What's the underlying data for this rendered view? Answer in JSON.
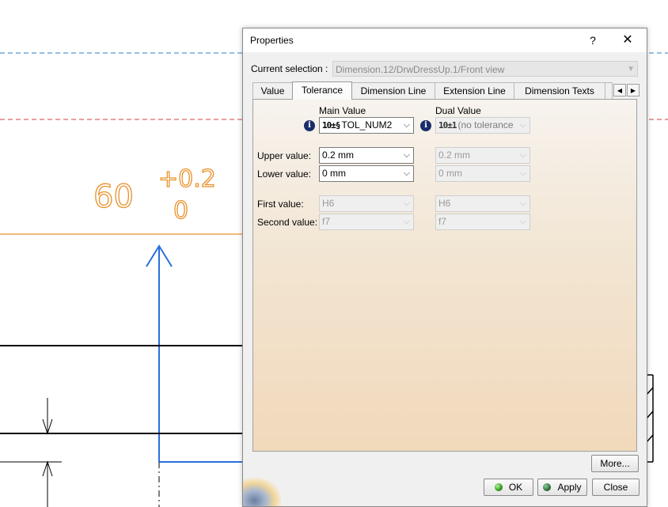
{
  "drawing": {
    "dimension_value": "60",
    "upper_tolerance": "+0.2",
    "lower_tolerance": "0",
    "colors": {
      "dim_text": "#e8912a",
      "dim_line": "#e8912a",
      "arrow": "#2a6fdb",
      "axis_blue": "#2a7fc4",
      "axis_red": "#d04040"
    }
  },
  "dialog": {
    "title": "Properties",
    "help_label": "?",
    "close_glyph": "✕",
    "current_selection_label": "Current selection :",
    "current_selection_value": "Dimension.12/DrwDressUp.1/Front view",
    "tabs": [
      "Value",
      "Tolerance",
      "Dimension Line",
      "Extension Line",
      "Dimension Texts"
    ],
    "active_tab": "Tolerance",
    "scroll_left": "◀",
    "scroll_right": "▶",
    "main_value_header": "Main Value",
    "dual_value_header": "Dual Value",
    "main_format_icon": "10±§",
    "main_format": "TOL_NUM2",
    "dual_format_icon": "10±1",
    "dual_format": "(no tolerance",
    "upper_value_label": "Upper value:",
    "lower_value_label": "Lower value:",
    "first_value_label": "First value:",
    "second_value_label": "Second value:",
    "main_upper": "0.2 mm",
    "main_lower": "0 mm",
    "dual_upper": "0.2 mm",
    "dual_lower": "0 mm",
    "main_first": "H6",
    "main_second": "f7",
    "dual_first": "H6",
    "dual_second": "f7",
    "more_label": "More...",
    "ok_label": "OK",
    "apply_label": "Apply",
    "close_label": "Close",
    "info_glyph": "i",
    "combo_arrow": "⌵"
  }
}
